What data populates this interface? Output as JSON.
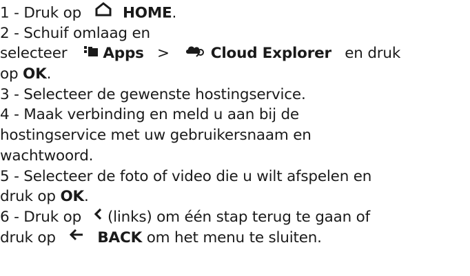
{
  "steps": {
    "s1": {
      "num": "1 - ",
      "pre": "Druk op",
      "key": "HOME",
      "post": "."
    },
    "s2": {
      "line1": "2 -  Schuif omlaag en",
      "pre": "selecteer",
      "apps": "Apps",
      "sep": ">",
      "cloud": "Cloud Explorer",
      "post": "en druk",
      "line3_pre": "op",
      "line3_key": "OK",
      "line3_post": "."
    },
    "s3": {
      "text": "3 -  Selecteer de gewenste hostingservice."
    },
    "s4": {
      "line1": "4 -  Maak verbinding en meld u aan bij de",
      "line2": "hostingservice met uw gebruikersnaam en",
      "line3": "wachtwoord."
    },
    "s5": {
      "line1": "5 -  Selecteer de foto of video die u wilt afspelen en",
      "pre": "druk op",
      "key": "OK",
      "post": "."
    },
    "s6": {
      "num": "6 -  Druk op",
      "rest1": "(links) om één stap terug te gaan of",
      "pre": "druk op",
      "key": "BACK",
      "post": "om het menu te sluiten."
    }
  },
  "icons": {
    "home": "home-icon",
    "apps": "apps-icon",
    "cloud": "cloud-search-icon",
    "left": "chevron-left-icon",
    "back": "back-arrow-icon"
  }
}
